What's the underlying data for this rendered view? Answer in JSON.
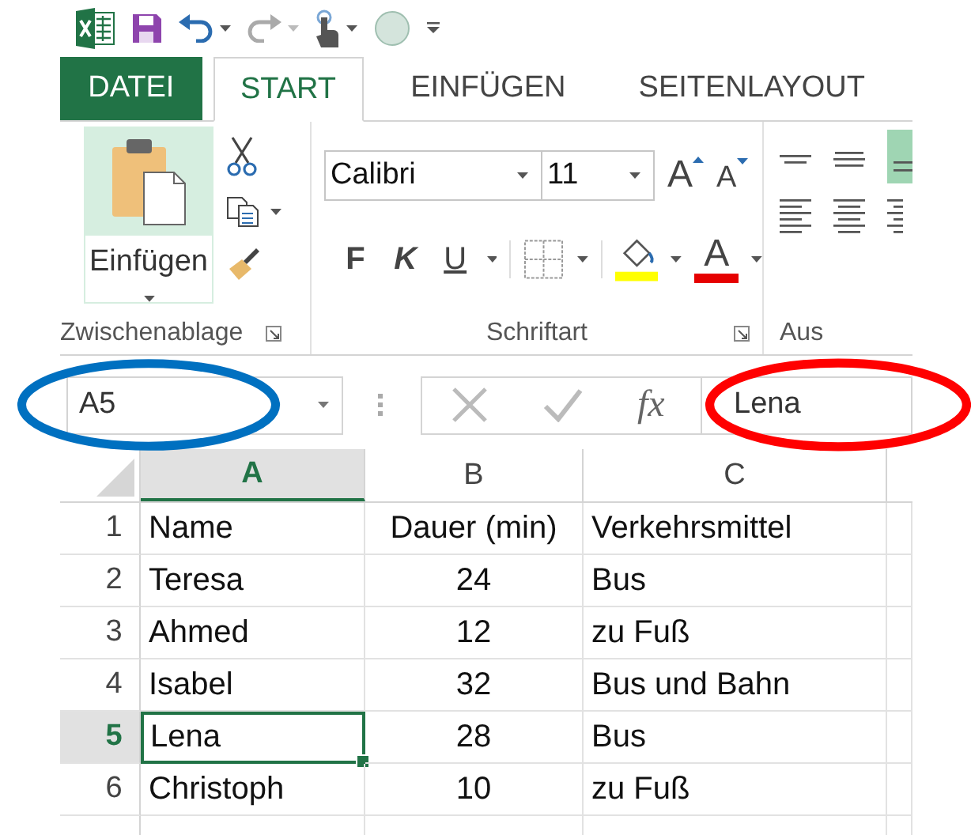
{
  "tabs": [
    {
      "label": "DATEI",
      "kind": "file",
      "selected": false
    },
    {
      "label": "START",
      "kind": "tab",
      "selected": true
    },
    {
      "label": "EINFÜGEN",
      "kind": "tab",
      "selected": false
    },
    {
      "label": "SEITENLAYOUT",
      "kind": "tab",
      "selected": false
    }
  ],
  "ribbon": {
    "clipboard": {
      "paste_label": "Einfügen",
      "group_label": "Zwischenablage"
    },
    "font": {
      "font_name": "Calibri",
      "font_size": "11",
      "grow_label": "A",
      "shrink_label": "A",
      "format_buttons": [
        {
          "label": "F",
          "kind": "bold"
        },
        {
          "label": "K",
          "kind": "italic"
        },
        {
          "label": "U",
          "kind": "underline"
        }
      ],
      "font_color_label": "A",
      "group_label": "Schriftart"
    },
    "alignment": {
      "group_label": "Aus"
    }
  },
  "formula_bar": {
    "name_box": "A5",
    "fx_label": "fx",
    "formula": "Lena"
  },
  "columns": [
    {
      "label": "A",
      "selected": true
    },
    {
      "label": "B",
      "selected": false
    },
    {
      "label": "C",
      "selected": false
    }
  ],
  "rows": [
    {
      "number": "1",
      "selected": false,
      "cells": [
        {
          "text": "Name",
          "selected": false
        },
        {
          "text": "Dauer (min)",
          "selected": false
        },
        {
          "text": "Verkehrsmittel",
          "selected": false
        }
      ]
    },
    {
      "number": "2",
      "selected": false,
      "cells": [
        {
          "text": "Teresa",
          "selected": false
        },
        {
          "text": "24",
          "selected": false
        },
        {
          "text": "Bus",
          "selected": false
        }
      ]
    },
    {
      "number": "3",
      "selected": false,
      "cells": [
        {
          "text": "Ahmed",
          "selected": false
        },
        {
          "text": "12",
          "selected": false
        },
        {
          "text": "zu Fuß",
          "selected": false
        }
      ]
    },
    {
      "number": "4",
      "selected": false,
      "cells": [
        {
          "text": "Isabel",
          "selected": false
        },
        {
          "text": "32",
          "selected": false
        },
        {
          "text": "Bus und Bahn",
          "selected": false
        }
      ]
    },
    {
      "number": "5",
      "selected": true,
      "cells": [
        {
          "text": "Lena",
          "selected": true
        },
        {
          "text": "28",
          "selected": false
        },
        {
          "text": "Bus",
          "selected": false
        }
      ]
    },
    {
      "number": "6",
      "selected": false,
      "cells": [
        {
          "text": "Christoph",
          "selected": false
        },
        {
          "text": "10",
          "selected": false
        },
        {
          "text": "zu Fuß",
          "selected": false
        }
      ]
    }
  ],
  "annotations": [
    {
      "color": "#0070c0"
    },
    {
      "color": "#ff0000"
    }
  ]
}
